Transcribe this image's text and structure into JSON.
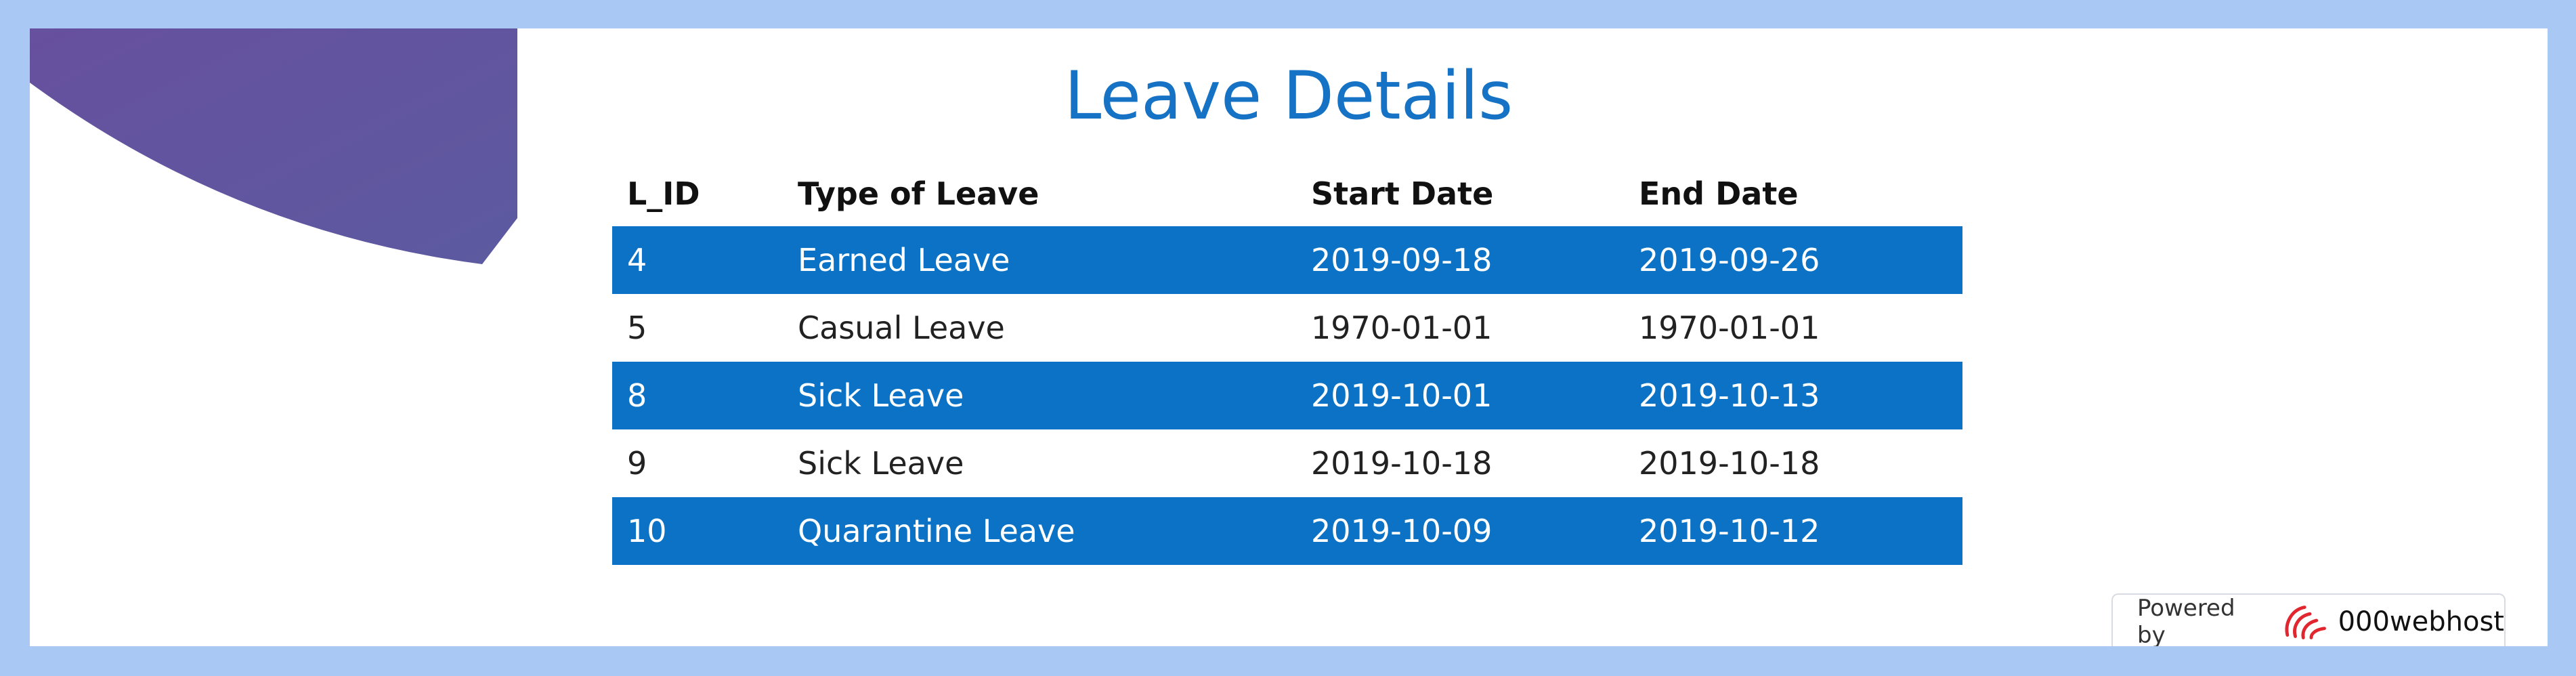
{
  "page": {
    "title": "Leave Details"
  },
  "table": {
    "headers": [
      "L_ID",
      "Type of Leave",
      "Start Date",
      "End Date"
    ],
    "rows": [
      {
        "id": "4",
        "type": "Earned Leave",
        "start": "2019-09-18",
        "end": "2019-09-26"
      },
      {
        "id": "5",
        "type": "Casual Leave",
        "start": "1970-01-01",
        "end": "1970-01-01"
      },
      {
        "id": "8",
        "type": "Sick Leave",
        "start": "2019-10-01",
        "end": "2019-10-13"
      },
      {
        "id": "9",
        "type": "Sick Leave",
        "start": "2019-10-18",
        "end": "2019-10-18"
      },
      {
        "id": "10",
        "type": "Quarantine Leave",
        "start": "2019-10-09",
        "end": "2019-10-12"
      }
    ]
  },
  "footer": {
    "powered_by": "Powered by",
    "host_name": "000webhost",
    "logo_icon": "000webhost-logo-icon"
  },
  "colors": {
    "title": "#1572c4",
    "row_highlight": "#0b72c6",
    "frame": "#a9c8f3",
    "deco_purple": "#5a56a0"
  }
}
